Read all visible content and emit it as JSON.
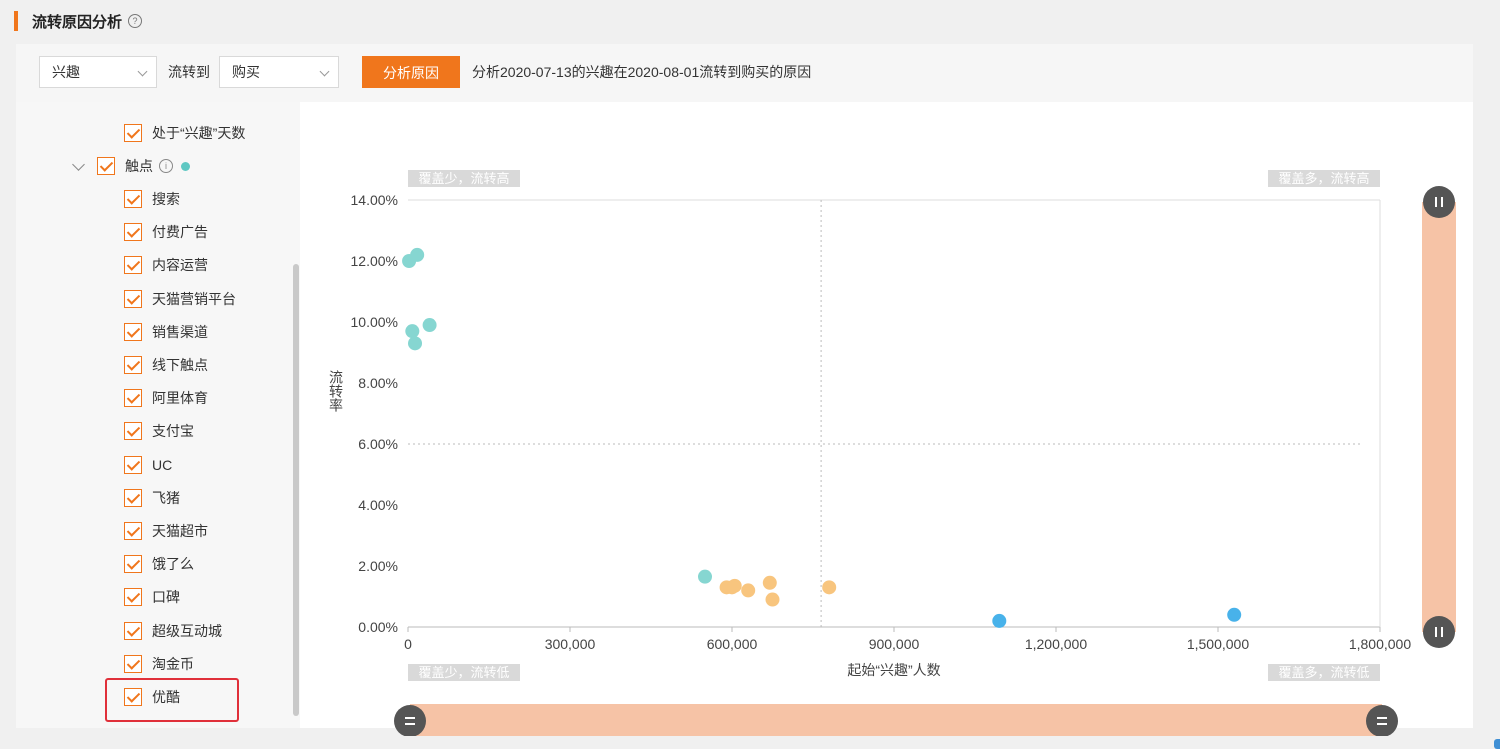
{
  "header": {
    "title": "流转原因分析",
    "help_icon": "?"
  },
  "toolbar": {
    "from_select": "兴趣",
    "flow_label": "流转到",
    "to_select": "购买",
    "analyze_button": "分析原因",
    "description": "分析2020-07-13的兴趣在2020-08-01流转到购买的原因"
  },
  "tree": {
    "top_item": "处于“兴趣”天数",
    "group": {
      "label": "触点",
      "info_icon": "i",
      "dot_color": "#5fc8c3"
    },
    "children": [
      "搜索",
      "付费广告",
      "内容运营",
      "天猫营销平台",
      "销售渠道",
      "线下触点",
      "阿里体育",
      "支付宝",
      "UC",
      "飞猪",
      "天猫超市",
      "饿了么",
      "口碑",
      "超级互动城",
      "淘金币",
      "优酷"
    ],
    "highlighted": "优酷"
  },
  "chart_data": {
    "type": "scatter",
    "xlabel": "起始“兴趣”人数",
    "ylabel": "流转率",
    "xlim": [
      0,
      1800000
    ],
    "ylim": [
      0,
      0.14
    ],
    "x_ticks": [
      0,
      300000,
      600000,
      900000,
      1200000,
      1500000,
      1800000
    ],
    "x_tick_labels": [
      "0",
      "300,000",
      "600,000",
      "900,000",
      "1,200,000",
      "1,500,000",
      "1,800,000"
    ],
    "y_ticks": [
      0,
      0.02,
      0.04,
      0.06,
      0.08,
      0.1,
      0.12,
      0.14
    ],
    "y_tick_labels": [
      "0.00%",
      "2.00%",
      "4.00%",
      "6.00%",
      "8.00%",
      "10.00%",
      "12.00%",
      "14.00%"
    ],
    "quadrant_split": {
      "x": 765000,
      "y": 0.06
    },
    "quadrant_labels": {
      "top_left": "覆盖少，流转高",
      "top_right": "覆盖多，流转高",
      "bottom_left": "覆盖少，流转低",
      "bottom_right": "覆盖多，流转低"
    },
    "grid": false,
    "legend": "none",
    "series": [
      {
        "color": "#86d6d1",
        "points": [
          [
            2000,
            0.12
          ],
          [
            17000,
            0.122
          ],
          [
            8000,
            0.097
          ],
          [
            13000,
            0.093
          ],
          [
            40000,
            0.099
          ],
          [
            550000,
            0.0165
          ]
        ]
      },
      {
        "color": "#f8c57e",
        "points": [
          [
            590000,
            0.013
          ],
          [
            600000,
            0.013
          ],
          [
            605000,
            0.0135
          ],
          [
            630000,
            0.012
          ],
          [
            670000,
            0.0145
          ],
          [
            675000,
            0.009
          ],
          [
            780000,
            0.013
          ]
        ]
      },
      {
        "color": "#48b2ea",
        "points": [
          [
            1095000,
            0.002
          ],
          [
            1530000,
            0.004
          ]
        ]
      }
    ],
    "zoom_slider_color": "#f6c3a6",
    "zoom_handle_color": "#555555"
  }
}
